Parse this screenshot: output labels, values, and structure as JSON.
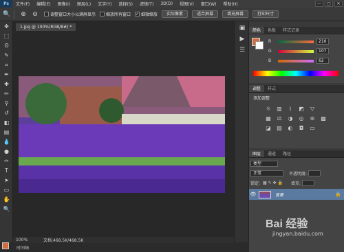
{
  "app": {
    "logo": "Ps"
  },
  "menu": [
    "文件(F)",
    "编辑(E)",
    "图像(I)",
    "图层(L)",
    "文字(Y)",
    "选择(S)",
    "滤镜(T)",
    "3D(D)",
    "视图(V)",
    "窗口(W)",
    "帮助(H)"
  ],
  "window_controls": [
    "—",
    "□",
    "✕"
  ],
  "options_bar": {
    "resize_windows_label": "调整窗口大小以满屏显示",
    "zoom_all_label": "缩放所有窗口",
    "scrubby_zoom_label": "细微缩放",
    "actual_pixels_btn": "实际像素",
    "fit_screen_btn": "适合屏幕",
    "fill_screen_btn": "填充屏幕",
    "print_size_btn": "打印尺寸"
  },
  "document": {
    "tab_title": "1.jpg @ 100%(RGB/8#) *",
    "zoom": "100%",
    "doc_info": "文档:468.5K/468.5K",
    "bottom_tab": "时间轴"
  },
  "color_panel": {
    "tabs": [
      "颜色",
      "色板",
      "样式记录"
    ],
    "r_label": "R",
    "r_value": "210",
    "g_label": "G",
    "g_value": "107",
    "b_label": "B",
    "b_value": "62",
    "fg_color": "#d26b3e"
  },
  "adjustments_panel": {
    "tabs": [
      "调整",
      "样式"
    ],
    "title": "添加调整"
  },
  "layers_panel": {
    "tabs": [
      "图层",
      "通道",
      "路径"
    ],
    "kind_placeholder": "类型",
    "blend_mode": "正常",
    "opacity_label": "不透明度:",
    "lock_label": "锁定:",
    "fill_label": "填充:",
    "layer_name": "背景"
  },
  "watermark": {
    "logo": "Bai 经验",
    "url": "jingyan.baidu.com"
  },
  "tools": [
    "move-icon",
    "marquee-icon",
    "lasso-icon",
    "quick-select-icon",
    "crop-icon",
    "eyedropper-icon",
    "healing-icon",
    "brush-icon",
    "clone-stamp-icon",
    "history-brush-icon",
    "eraser-icon",
    "gradient-icon",
    "blur-icon",
    "dodge-icon",
    "pen-icon",
    "type-icon",
    "path-select-icon",
    "shape-icon",
    "hand-icon",
    "zoom-icon"
  ]
}
